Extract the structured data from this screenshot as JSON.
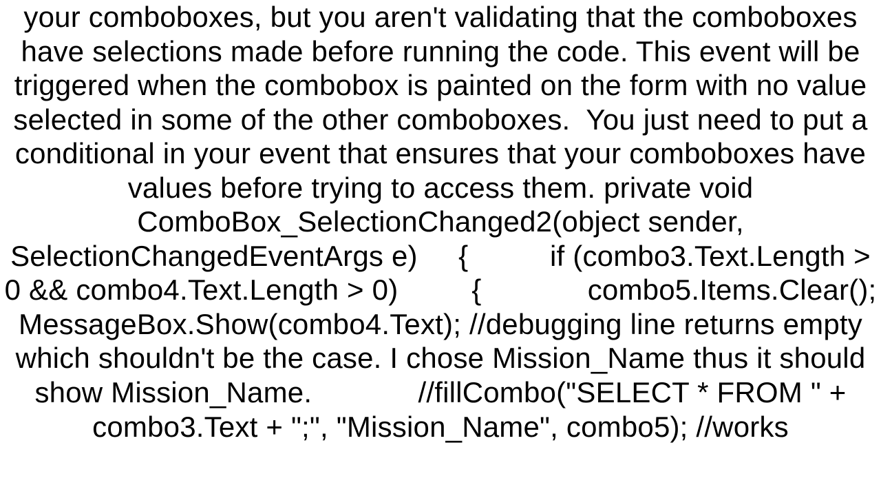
{
  "body": {
    "text": "your comboboxes, but you aren't validating that the comboboxes have selections made before running the code. This event will be triggered when the combobox is painted on the form with no value selected in some of the other comboboxes.  You just need to put a conditional in your event that ensures that your comboboxes have values before trying to access them. private void ComboBox_SelectionChanged2(object sender, SelectionChangedEventArgs e)     {          if (combo3.Text.Length > 0 && combo4.Text.Length > 0)         {             combo5.Items.Clear();             MessageBox.Show(combo4.Text); //debugging line returns empty which shouldn't be the case. I chose Mission_Name thus it should show Mission_Name.             //fillCombo(\"SELECT * FROM \" + combo3.Text + \";\", \"Mission_Name\", combo5); //works"
  }
}
